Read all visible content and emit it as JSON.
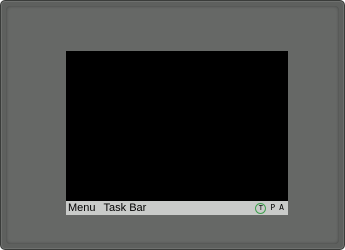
{
  "taskbar": {
    "menu_label": "Menu",
    "title": "Task Bar",
    "tray": {
      "t_label": "T",
      "p_label": "P",
      "a_label": "A"
    }
  },
  "colors": {
    "bezel": "#5e605e",
    "screen": "#000000",
    "taskbar": "#c9cbc9",
    "tray_ring": "#3fa04f"
  }
}
